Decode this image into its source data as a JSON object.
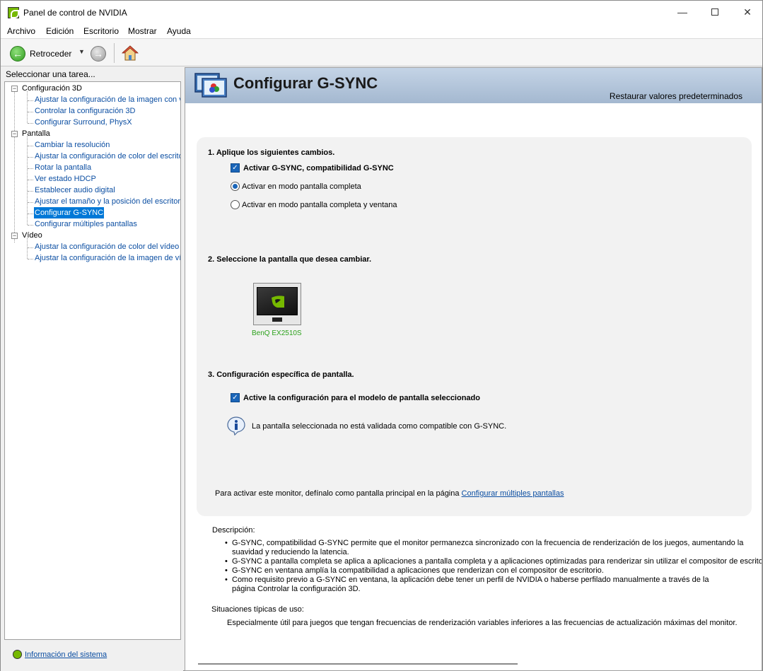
{
  "window": {
    "title": "Panel de control de NVIDIA"
  },
  "menu": [
    "Archivo",
    "Edición",
    "Escritorio",
    "Mostrar",
    "Ayuda"
  ],
  "toolbar": {
    "back_label": "Retroceder"
  },
  "left": {
    "header": "Seleccionar una tarea...",
    "categories": {
      "c3d": "Configuración 3D",
      "pantalla": "Pantalla",
      "video": "Vídeo"
    },
    "items_3d": [
      "Ajustar la configuración de la imagen con v",
      "Controlar la configuración 3D",
      "Configurar Surround, PhysX"
    ],
    "items_pantalla": [
      "Cambiar la resolución",
      "Ajustar la configuración de color del escrito",
      "Rotar la pantalla",
      "Ver estado HDCP",
      "Establecer audio digital",
      "Ajustar el tamaño y la posición del escritori",
      "Configurar G-SYNC",
      "Configurar múltiples pantallas"
    ],
    "items_video": [
      "Ajustar la configuración de color del vídeo",
      "Ajustar la configuración de la imagen de víc"
    ],
    "sysinfo": "Información del sistema"
  },
  "page": {
    "title": "Configurar G-SYNC",
    "restore": "Restaurar valores predeterminados",
    "section1": "1. Aplique los siguientes cambios.",
    "enable_gsync": "Activar G-SYNC, compatibilidad G-SYNC",
    "radio_full": "Activar en modo pantalla completa",
    "radio_window": "Activar en modo pantalla completa y ventana",
    "section2": "2. Seleccione la pantalla que desea cambiar.",
    "monitor_name": "BenQ EX2510S",
    "section3": "3. Configuración específica de pantalla.",
    "enable_model": "Active la configuración para el modelo de pantalla seleccionado",
    "info_text": "La pantalla seleccionada no está validada como compatible con G-SYNC.",
    "bottom_text": "Para activar este monitor, defínalo como pantalla principal en la página ",
    "bottom_link": "Configurar múltiples pantallas",
    "desc_title": "Descripción:",
    "desc_bullets": [
      "G-SYNC, compatibilidad G-SYNC permite que el monitor permanezca sincronizado con la frecuencia de renderización de los juegos, aumentando la suavidad y reduciendo la latencia.",
      "G-SYNC a pantalla completa se aplica a aplicaciones a pantalla completa y a aplicaciones optimizadas para renderizar sin utilizar el compositor de escritorio.",
      "G-SYNC en ventana amplía la compatibilidad a aplicaciones que renderizan con el compositor de escritorio.",
      "Como requisito previo a G-SYNC en ventana, la aplicación debe tener un perfil de NVIDIA o haberse perfilado manualmente a través de la página Controlar la configuración 3D."
    ],
    "usage_title": "Situaciones típicas de uso:",
    "usage_text": "Especialmente útil para juegos que tengan frecuencias de renderización variables inferiores a las frecuencias de actualización máximas del monitor."
  },
  "colors": {
    "accent": "#76b900",
    "link": "#0b4ea2",
    "selection": "#0078d7",
    "header_bg": "#b4c6dc"
  }
}
